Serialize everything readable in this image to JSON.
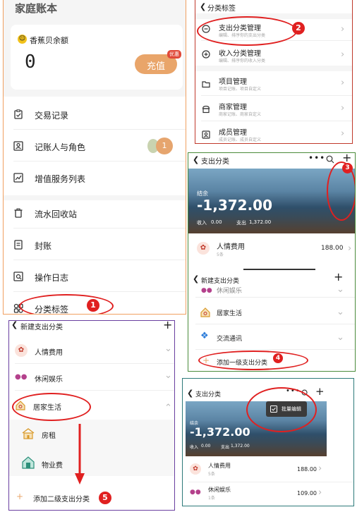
{
  "panel_main": {
    "title": "家庭账本",
    "balance_label": "香蕉贝余额",
    "balance_value": "0",
    "recharge_button": "充值",
    "recharge_tag": "优惠",
    "menu": [
      {
        "label": "交易记录",
        "icon": "clipboard-icon"
      },
      {
        "label": "记账人与角色",
        "icon": "person-card-icon",
        "count": "1"
      },
      {
        "label": "增值服务列表",
        "icon": "chart-icon"
      },
      {
        "label": "流水回收站",
        "icon": "trash-icon"
      },
      {
        "label": "封账",
        "icon": "ledger-icon"
      },
      {
        "label": "操作日志",
        "icon": "log-icon"
      },
      {
        "label": "分类标签",
        "icon": "tags-icon"
      }
    ],
    "step_badge": "1"
  },
  "panel_tags": {
    "title": "分类标签",
    "items": [
      {
        "label": "支出分类管理",
        "sub": "编辑、排序你的支出分类",
        "icon": "minus-circle-icon"
      },
      {
        "label": "收入分类管理",
        "sub": "编辑、排序你的收入分类",
        "icon": "plus-circle-icon"
      },
      {
        "label": "项目管理",
        "sub": "项目记账、项目自定义",
        "icon": "folder-icon"
      },
      {
        "label": "商家管理",
        "sub": "商家记账、商家自定义",
        "icon": "shop-icon"
      },
      {
        "label": "成员管理",
        "sub": "成员记账、成员自定义",
        "icon": "member-icon"
      }
    ],
    "step_badge": "2"
  },
  "panel_expense": {
    "title": "支出分类",
    "balance_label": "结余",
    "balance": "-1,372.00",
    "income_label": "收入",
    "income": "0.00",
    "expense_label": "支出",
    "expense": "1,372.00",
    "first_item": {
      "label": "人情费用",
      "sub": "5条",
      "amount": "188.00"
    },
    "step_badge_menu": "3"
  },
  "panel_new_l1": {
    "title": "新建支出分类",
    "items": [
      {
        "label": "休闲娱乐",
        "icon": "gamepad-icon"
      },
      {
        "label": "居家生活",
        "icon": "home-icon"
      },
      {
        "label": "交流通讯",
        "icon": "signal-icon"
      }
    ],
    "add_label": "添加一级支出分类",
    "step_badge": "4"
  },
  "panel_new_l2": {
    "title": "新建支出分类",
    "items": [
      {
        "label": "人情费用",
        "icon": "gift-icon"
      },
      {
        "label": "休闲娱乐",
        "icon": "gamepad-icon"
      },
      {
        "label": "居家生活",
        "icon": "home-icon"
      }
    ],
    "sub_items": [
      {
        "label": "房租",
        "icon": "house-icon"
      },
      {
        "label": "物业费",
        "icon": "building-icon"
      }
    ],
    "add_label": "添加二级支出分类",
    "step_badge": "5"
  },
  "panel_batch": {
    "title": "支出分类",
    "popup_label": "批量编辑",
    "balance_label": "结余",
    "balance": "-1,372.00",
    "income_label": "收入",
    "income": "0.00",
    "expense_label": "支出",
    "expense": "1,372.00",
    "items": [
      {
        "label": "人情费用",
        "sub": "5条",
        "amount": "188.00"
      },
      {
        "label": "休闲娱乐",
        "sub": "1条",
        "amount": "109.00"
      }
    ]
  }
}
